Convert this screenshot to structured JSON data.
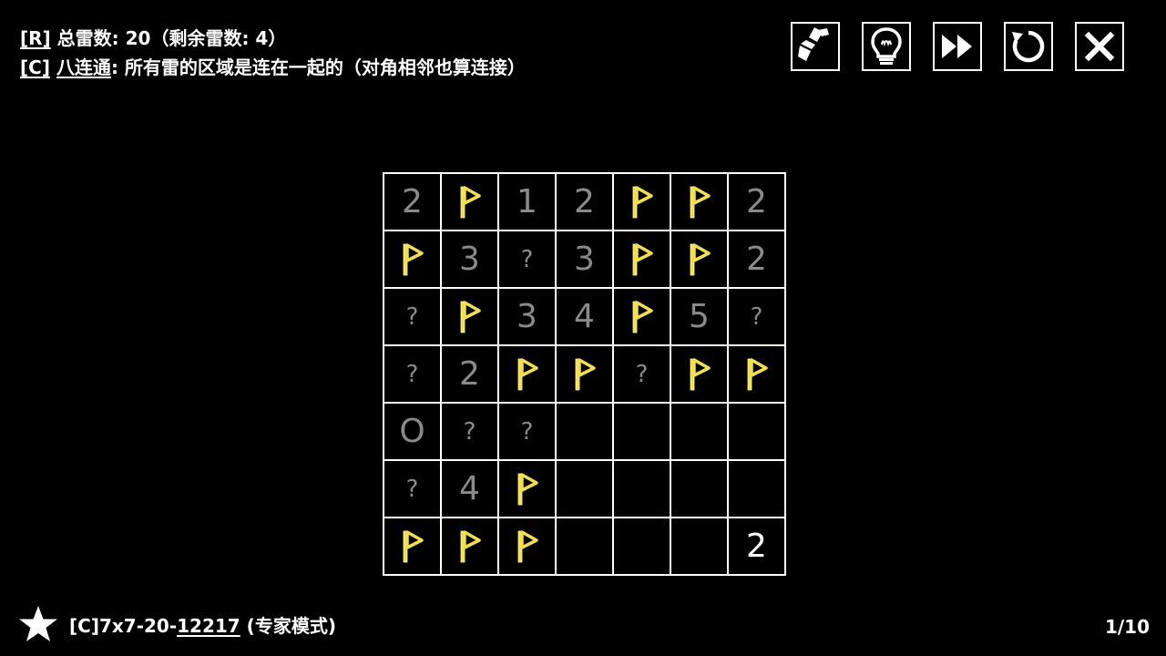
{
  "rules": {
    "r_tag": "[R]",
    "r_text": " 总雷数:  20（剩余雷数: 4）",
    "c_tag": "[C]",
    "c_name": "八连通",
    "c_text": ": 所有雷的区域是连在一起的（对角相邻也算连接）"
  },
  "toolbar": {
    "icons": [
      "paint-brush-icon",
      "light-bulb-icon",
      "fast-forward-icon",
      "restart-icon",
      "close-icon"
    ]
  },
  "board": {
    "size": 7,
    "rows": [
      [
        "2",
        "F",
        "1",
        "2",
        "F",
        "F",
        "2"
      ],
      [
        "F",
        "3",
        "?",
        "3",
        "F",
        "F",
        "2"
      ],
      [
        "?",
        "F",
        "3",
        "4",
        "F",
        "5",
        "?"
      ],
      [
        "?",
        "2",
        "F",
        "F",
        "?",
        "F",
        "F"
      ],
      [
        "O",
        "?",
        "?",
        "",
        "",
        "",
        ""
      ],
      [
        "?",
        "4",
        "F",
        "",
        "",
        "",
        ""
      ],
      [
        "F",
        "F",
        "F",
        "",
        "",
        "",
        "2*"
      ]
    ]
  },
  "footer": {
    "puzzle_prefix": "[C]7x7-20-",
    "puzzle_id": "12217",
    "mode": " (专家模式)",
    "page": "1/10"
  },
  "colors": {
    "background": "#000000",
    "flag": "#f2e04a",
    "clue_given": "#8a8a8a",
    "clue_user": "#ffffff",
    "grid": "#ffffff"
  }
}
